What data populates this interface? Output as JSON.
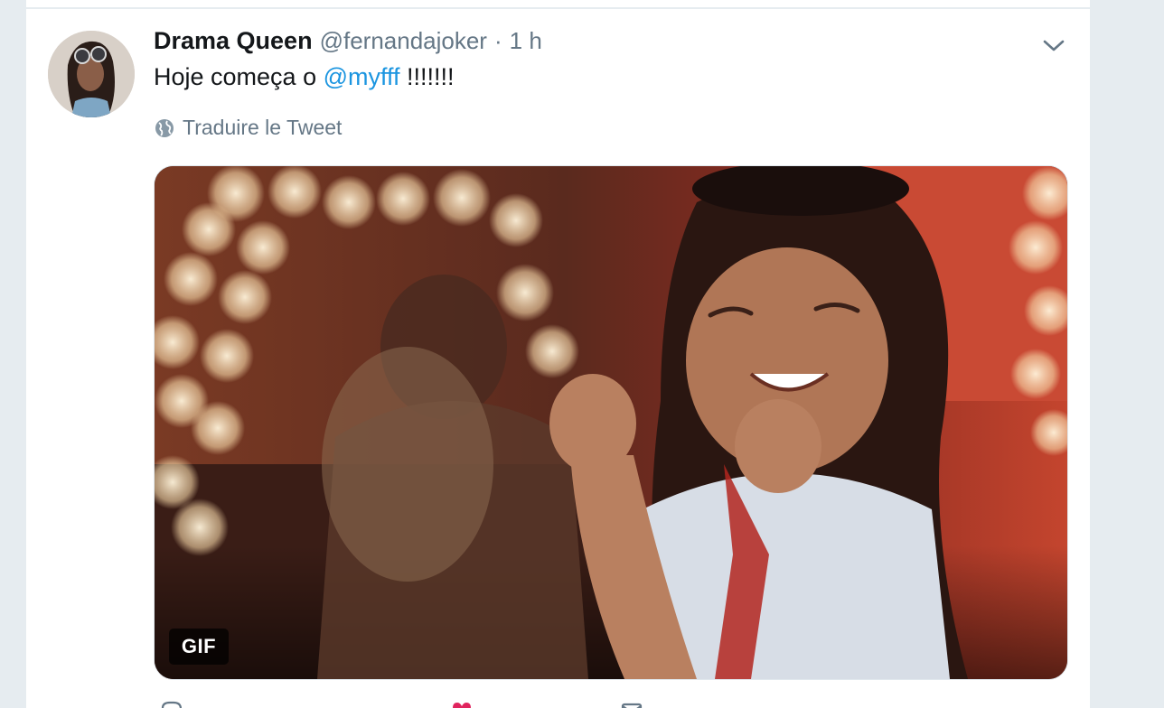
{
  "tweet": {
    "display_name": "Drama Queen",
    "handle": "@fernandajoker",
    "separator": "·",
    "timestamp": "1 h",
    "text_before": "Hoje começa o ",
    "mention": "@myfff",
    "text_after": " !!!!!!!",
    "translate_label": "Traduire le Tweet",
    "media_badge": "GIF"
  },
  "icons": {
    "caret": "chevron-down-icon",
    "translate": "globe-icon",
    "reply": "reply-icon",
    "like": "heart-icon",
    "message": "dm-icon"
  },
  "colors": {
    "link": "#1b95e0",
    "secondary_text": "#657786",
    "primary_text": "#14171a",
    "like": "#e0245e"
  }
}
